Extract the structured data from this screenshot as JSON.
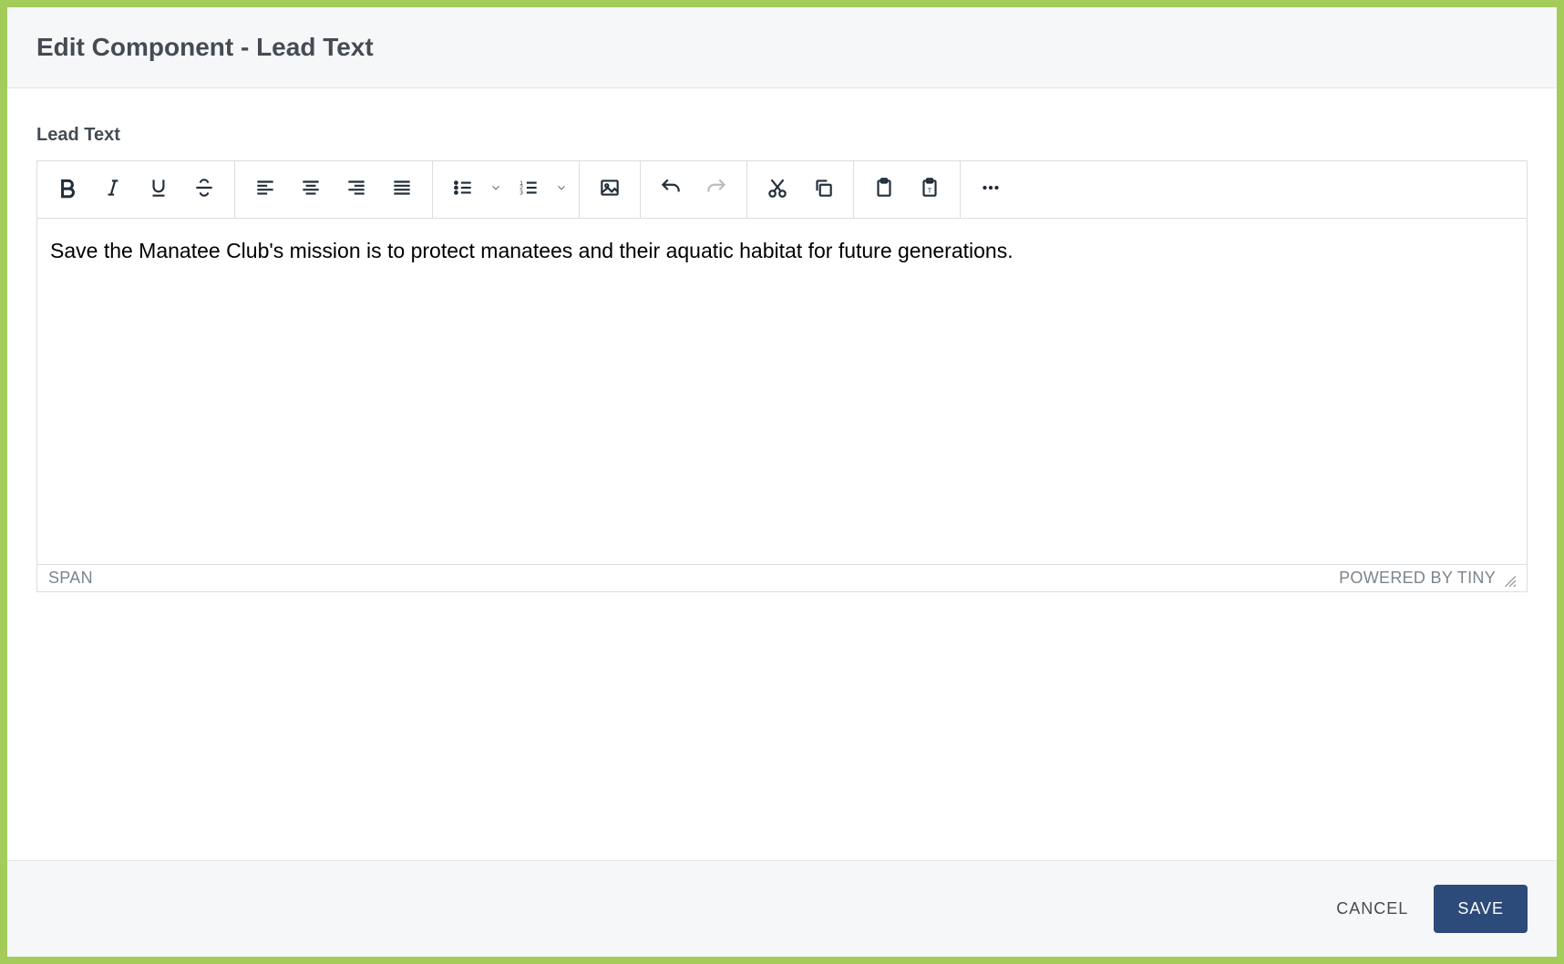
{
  "modal": {
    "title": "Edit Component - Lead Text"
  },
  "field": {
    "label": "Lead Text"
  },
  "editor": {
    "content": "Save the Manatee Club's mission is to protect manatees and their aquatic habitat for future generations.",
    "status_path": "SPAN",
    "branding": "POWERED BY TINY"
  },
  "footer": {
    "cancel": "CANCEL",
    "save": "SAVE"
  },
  "toolbar": {
    "bold": "Bold",
    "italic": "Italic",
    "underline": "Underline",
    "strike": "Strikethrough",
    "align_left": "Align left",
    "align_center": "Align center",
    "align_right": "Align right",
    "align_justify": "Justify",
    "bullet_list": "Bullet list",
    "number_list": "Numbered list",
    "image": "Insert image",
    "undo": "Undo",
    "redo": "Redo",
    "cut": "Cut",
    "copy": "Copy",
    "paste": "Paste",
    "paste_text": "Paste as text",
    "more": "More"
  }
}
